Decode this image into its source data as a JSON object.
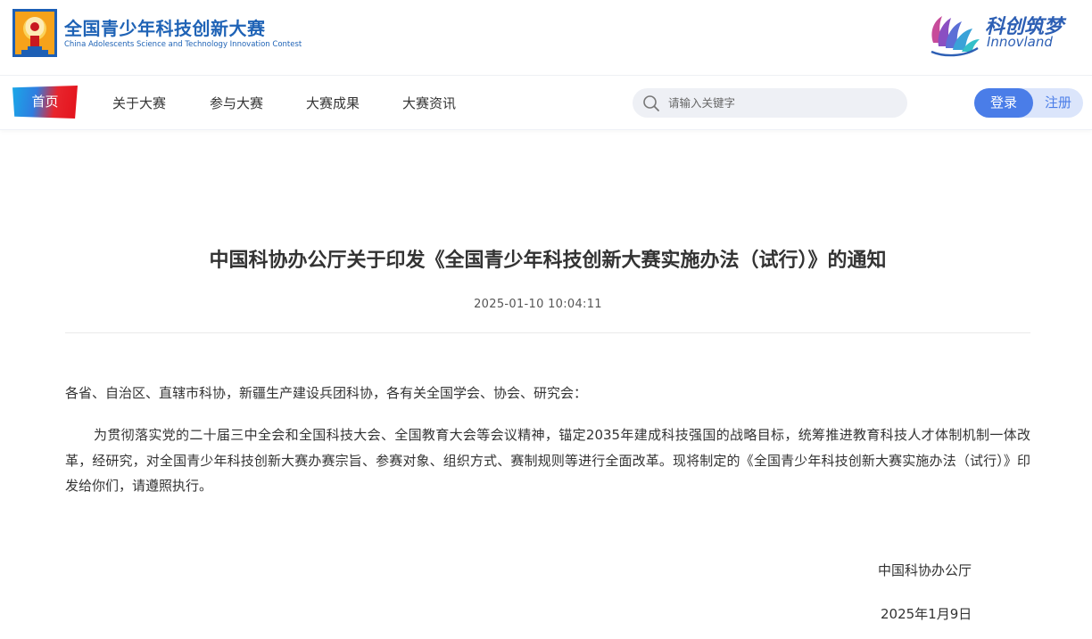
{
  "header": {
    "brand_title": "全国青少年科技创新大赛",
    "brand_subtitle": "China Adolescents Science and Technology Innovation Contest",
    "right_brand_cn": "科创筑梦",
    "right_brand_en": "Innovland"
  },
  "nav": {
    "home_label": "首页",
    "items": [
      {
        "label": "关于大赛"
      },
      {
        "label": "参与大赛"
      },
      {
        "label": "大赛成果"
      },
      {
        "label": "大赛资讯"
      }
    ],
    "search_placeholder": "请输入关键字",
    "login_label": "登录",
    "register_label": "注册"
  },
  "article": {
    "title": "中国科协办公厅关于印发《全国青少年科技创新大赛实施办法（试行）》的通知",
    "datetime": "2025-01-10 10:04:11",
    "salutation": "各省、自治区、直辖市科协，新疆生产建设兵团科协，各有关全国学会、协会、研究会：",
    "body": "为贯彻落实党的二十届三中全会和全国科技大会、全国教育大会等会议精神，锚定2035年建成科技强国的战略目标，统筹推进教育科技人才体制机制一体改革，经研究，对全国青少年科技创新大赛办赛宗旨、参赛对象、组织方式、赛制规则等进行全面改革。现将制定的《全国青少年科技创新大赛实施办法（试行）》印发给你们，请遵照执行。",
    "signer": "中国科协办公厅",
    "sign_date": "2025年1月9日"
  },
  "colors": {
    "brand_blue": "#1f63b6",
    "accent_blue": "#4a7de8",
    "home_red": "#e3121b"
  },
  "icons": {
    "left_logo": "contest-logo-icon",
    "right_logo": "innovland-logo-icon",
    "search": "search-icon"
  }
}
